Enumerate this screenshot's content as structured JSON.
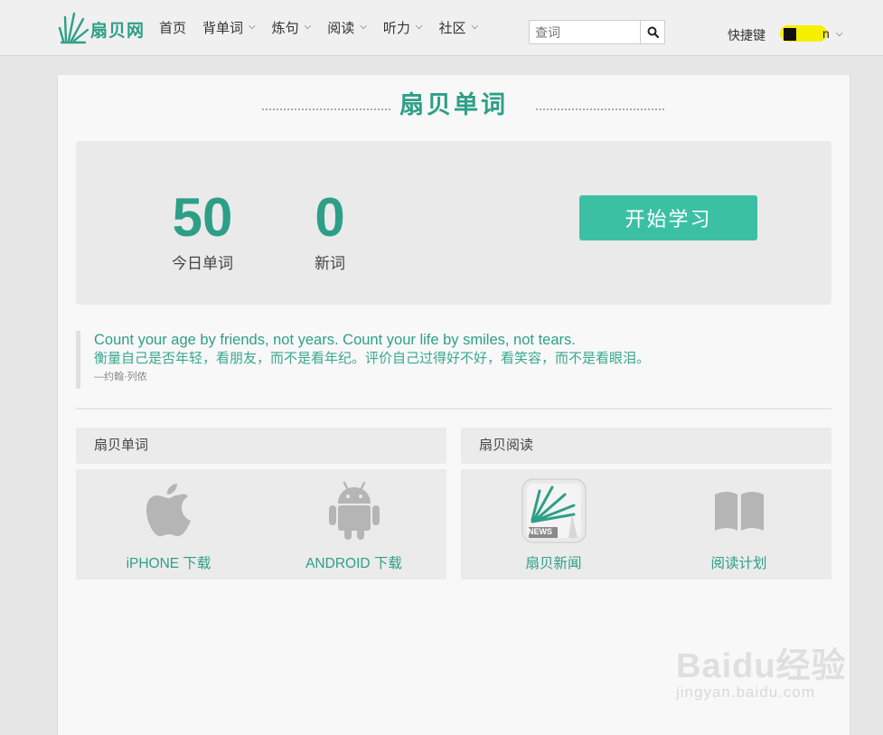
{
  "header": {
    "logo_text": "扇贝网",
    "nav": [
      {
        "label": "首页",
        "dropdown": false
      },
      {
        "label": "背单词",
        "dropdown": true
      },
      {
        "label": "炼句",
        "dropdown": true
      },
      {
        "label": "阅读",
        "dropdown": true
      },
      {
        "label": "听力",
        "dropdown": true
      },
      {
        "label": "社区",
        "dropdown": true
      }
    ],
    "search_placeholder": "查词",
    "search_icon": "search-icon",
    "shortcut_label": "快捷键",
    "username_visible": "n"
  },
  "main": {
    "title": "扇贝单词",
    "stats": {
      "today_count": "50",
      "today_label": "今日单词",
      "new_count": "0",
      "new_label": "新词"
    },
    "start_button": "开始学习",
    "quote": {
      "en": "Count your age by friends, not years. Count your life by smiles, not tears.",
      "zh": "衡量自己是否年轻，看朋友，而不是看年纪。评价自己过得好不好，看笑容，而不是看眼泪。",
      "author": "—约翰·列侬"
    },
    "panels": {
      "left": {
        "title": "扇贝单词",
        "tiles": [
          {
            "label": "iPHONE 下载",
            "icon": "apple-icon"
          },
          {
            "label": "ANDROID 下载",
            "icon": "android-icon"
          }
        ]
      },
      "right": {
        "title": "扇贝阅读",
        "tiles": [
          {
            "label": "扇贝新闻",
            "icon": "shanbay-news-icon",
            "badge": "NEWS"
          },
          {
            "label": "阅读计划",
            "icon": "open-book-icon"
          }
        ]
      }
    }
  },
  "watermark": {
    "main": "Baidu经验",
    "sub": "jingyan.baidu.com"
  },
  "colors": {
    "brand": "#2e9f87",
    "button": "#3cc0a4",
    "highlight": "#f7ef00"
  }
}
